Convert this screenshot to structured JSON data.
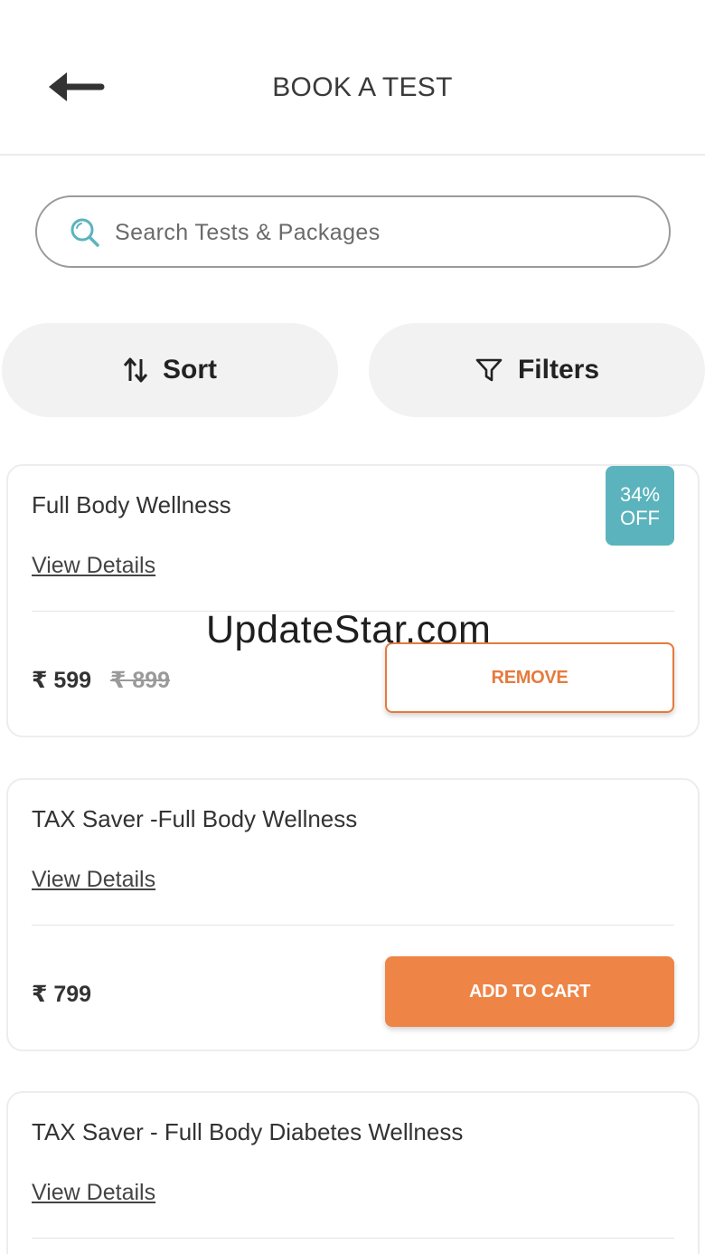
{
  "header": {
    "title": "BOOK A TEST",
    "back_icon": "arrow-left-icon"
  },
  "search": {
    "placeholder": "Search Tests & Packages",
    "value": "",
    "icon": "search-icon"
  },
  "controls": {
    "sort_label": "Sort",
    "sort_icon": "sort-arrows-icon",
    "filters_label": "Filters",
    "filters_icon": "funnel-icon"
  },
  "packages": [
    {
      "title": "Full Body Wellness",
      "view_details": "View Details",
      "discount_line1": "34%",
      "discount_line2": "OFF",
      "price": "₹ 599",
      "original_price": "₹ 899",
      "action_label": "REMOVE",
      "in_cart": true
    },
    {
      "title": "TAX Saver -Full Body Wellness",
      "view_details": "View Details",
      "price": "₹ 799",
      "action_label": "ADD TO CART",
      "in_cart": false
    },
    {
      "title": "TAX Saver - Full Body Diabetes Wellness",
      "view_details": "View Details"
    }
  ],
  "watermark": "UpdateStar.com",
  "colors": {
    "accent_orange": "#ee8446",
    "badge_teal": "#5bb4bd",
    "search_icon": "#5bb4bd"
  }
}
